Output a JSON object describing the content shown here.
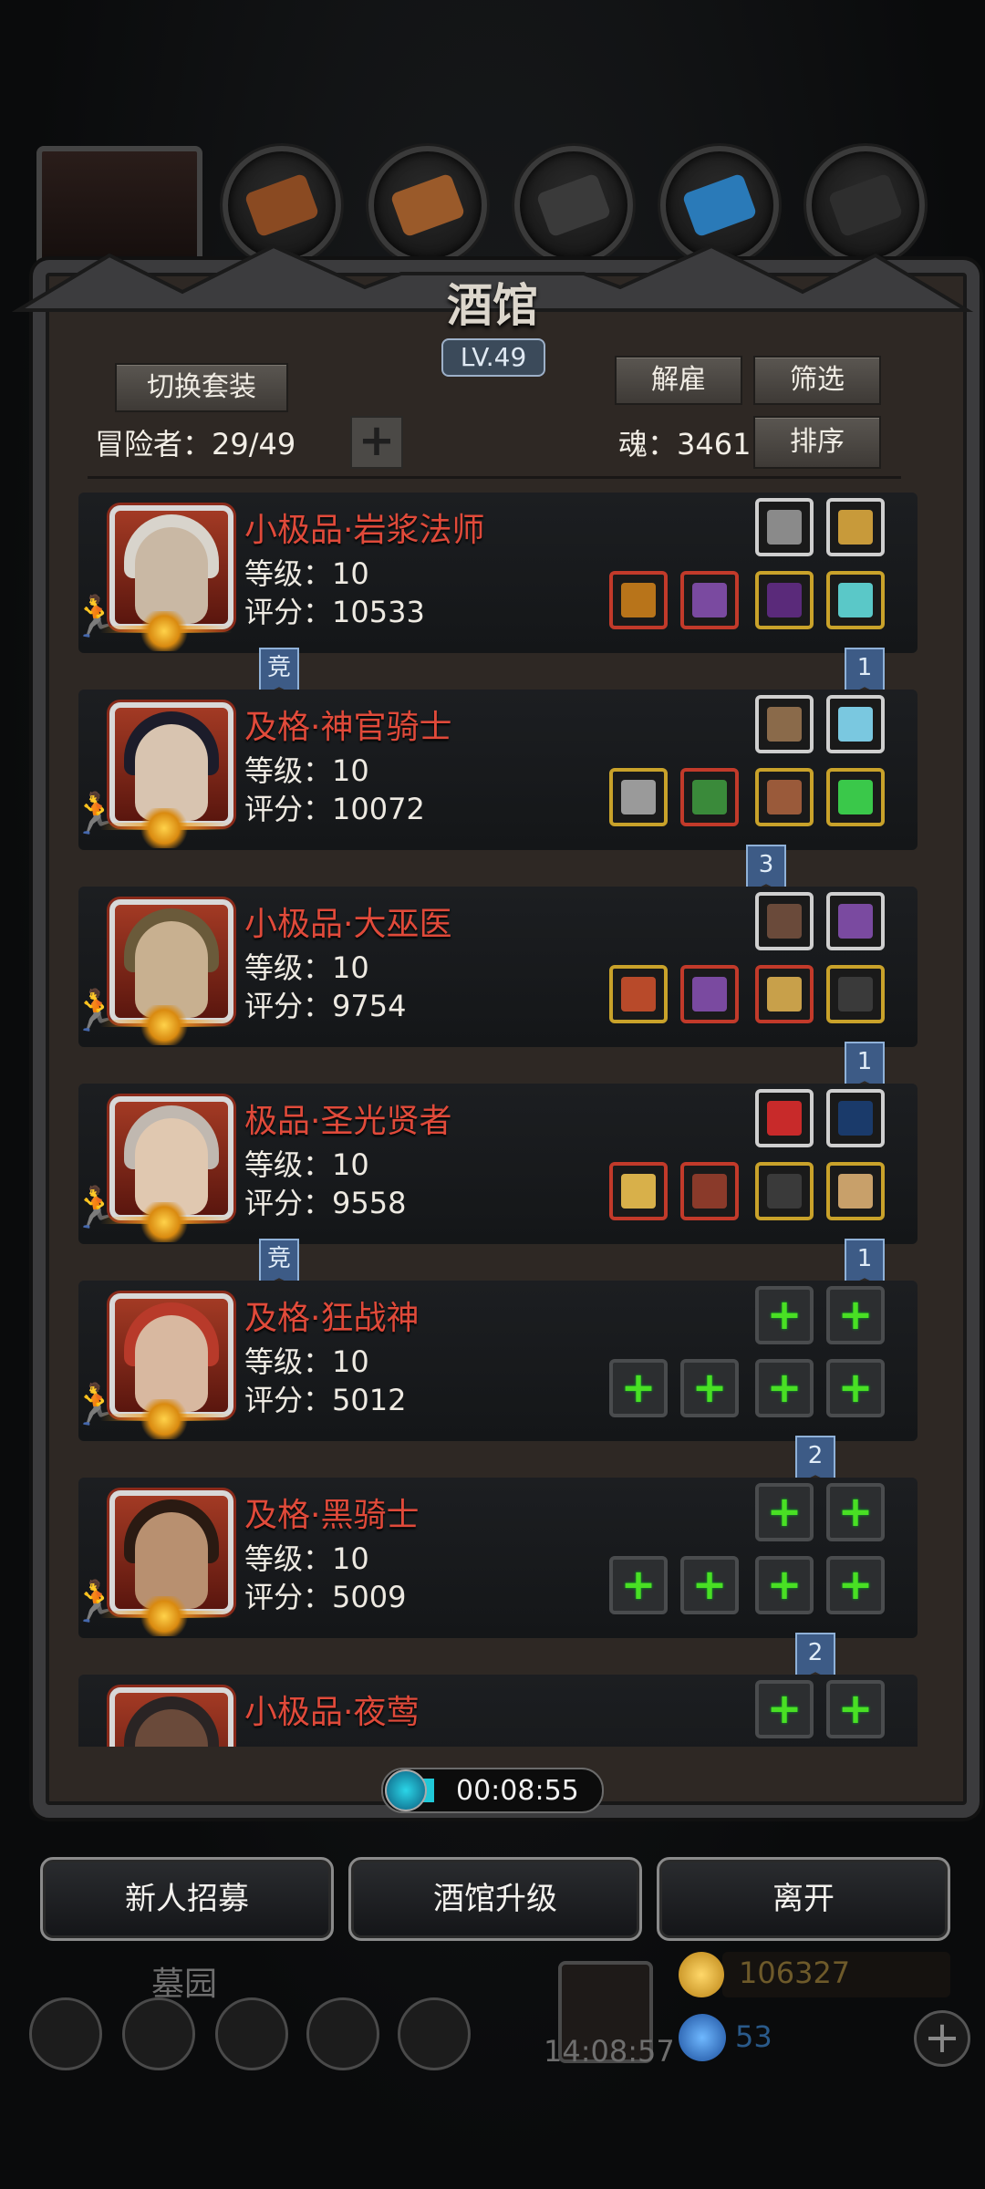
{
  "header": {
    "title": "酒馆",
    "level": "LV.49",
    "switch_outfit": "切换套装",
    "dismiss": "解雇",
    "filter": "筛选",
    "sort": "排序",
    "adventurers_label": "冒险者：29/49",
    "soul_label": "魂：3461"
  },
  "heroes": [
    {
      "name": "小极品·岩浆法师",
      "level": "等级：10",
      "score": "评分：10533",
      "badge_left": "竞",
      "badge_right": "1"
    },
    {
      "name": "及格·神官骑士",
      "level": "等级：10",
      "score": "评分：10072",
      "badge_mid": "3"
    },
    {
      "name": "小极品·大巫医",
      "level": "等级：10",
      "score": "评分：9754",
      "badge_right": "1"
    },
    {
      "name": "极品·圣光贤者",
      "level": "等级：10",
      "score": "评分：9558",
      "badge_left": "竞",
      "badge_right": "1"
    },
    {
      "name": "及格·狂战神",
      "level": "等级：10",
      "score": "评分：5012",
      "badge_mid": "2"
    },
    {
      "name": "及格·黑骑士",
      "level": "等级：10",
      "score": "评分：5009",
      "badge_mid": "2"
    },
    {
      "name": "小极品·夜莺",
      "level": "",
      "score": ""
    }
  ],
  "timer": "00:08:55",
  "actions": {
    "recruit": "新人招募",
    "upgrade": "酒馆升级",
    "leave": "离开"
  },
  "hud": {
    "location": "墓园",
    "clock": "14:08:57",
    "gold": "106327",
    "gems": "53"
  },
  "colors": {
    "hero_name": "#e04a3a",
    "add_slot_plus": "#49e024",
    "ribbon": "#3d5b86"
  }
}
